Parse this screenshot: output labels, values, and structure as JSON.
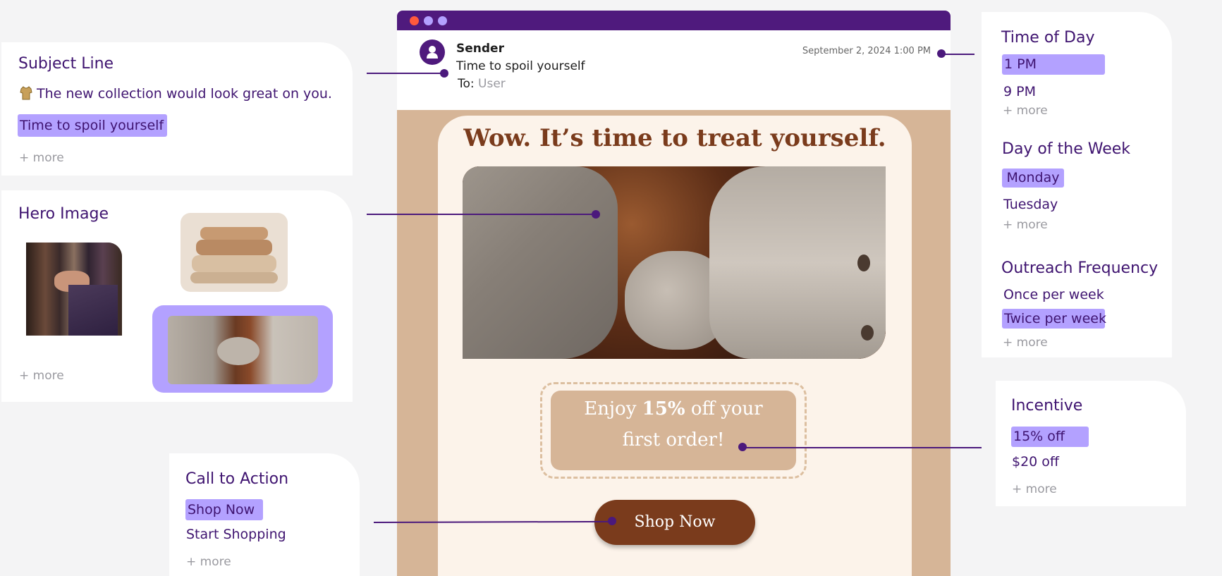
{
  "subject_card": {
    "title": "Subject Line",
    "option_1": "The new collection would look great on you.",
    "option_2": "Time to spoil yourself",
    "more": "+ more"
  },
  "hero_card": {
    "title": "Hero Image",
    "more": "+ more"
  },
  "cta_card": {
    "title": "Call to Action",
    "option_1": "Shop Now",
    "option_2": "Start Shopping",
    "more": "+ more"
  },
  "time_card": {
    "time_title": "Time of Day",
    "time_1": "1 PM",
    "time_2": "9 PM",
    "time_more": "+ more",
    "day_title": "Day of the Week",
    "day_1": "Monday",
    "day_2": "Tuesday",
    "day_more": "+ more",
    "freq_title": "Outreach Frequency",
    "freq_1": "Once per week",
    "freq_2": "Twice per week",
    "freq_more": "+ more"
  },
  "incentive_card": {
    "title": "Incentive",
    "option_1": "15% off",
    "option_2": "$20 off",
    "more": "+ more"
  },
  "email": {
    "sender": "Sender",
    "subject": "Time to spoil yourself",
    "to_label": "To:",
    "to_value": "User",
    "date": "September 2, 2024 1:00 PM",
    "headline": "Wow. It’s time to treat yourself.",
    "offer_pre": "Enjoy ",
    "offer_bold": "15%",
    "offer_post": " off your first order!",
    "button": "Shop Now"
  },
  "colors": {
    "accent": "#4f1a7d",
    "highlight": "#b3a1ff",
    "email_bg": "#d6b597",
    "email_inner": "#fcf3ea",
    "headline": "#7a3b1c",
    "button": "#7a3b1c"
  }
}
